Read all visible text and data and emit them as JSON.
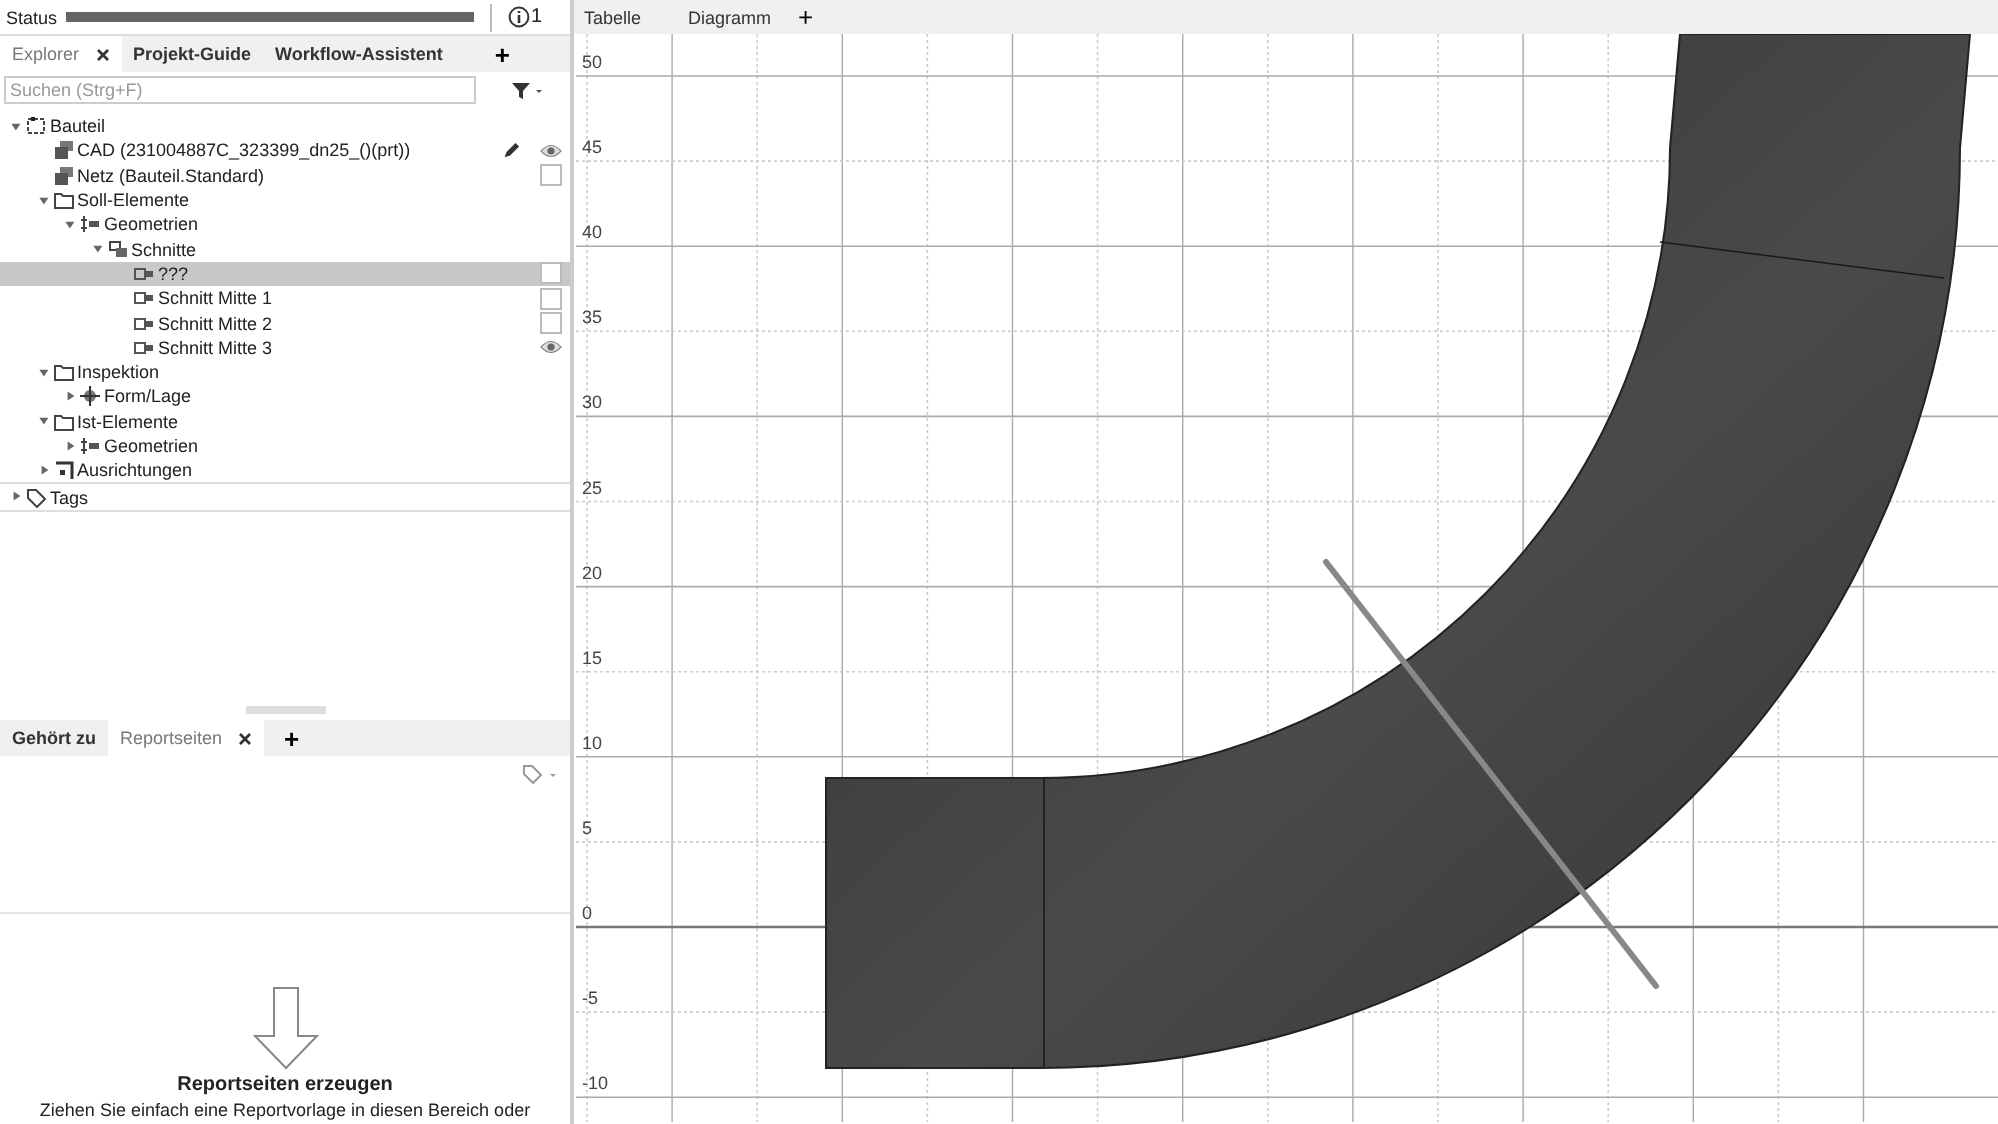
{
  "status_bar": {
    "label": "Status",
    "level": 1,
    "message_count": "1"
  },
  "left_tabs": [
    {
      "label": "Explorer",
      "selected": true,
      "closable": true
    },
    {
      "label": "Projekt-Guide",
      "selected": false,
      "closable": false
    },
    {
      "label": "Workflow-Assistent",
      "selected": false,
      "closable": false
    }
  ],
  "left_add_tab": "+",
  "search": {
    "placeholder": "Suchen (Strg+F)"
  },
  "tree": [
    {
      "label": "Bauteil",
      "kind": "part",
      "expanded": true,
      "children": [
        {
          "label": "CAD (231004887C_323399_dn25_()(prt))",
          "kind": "cad",
          "editable": true,
          "visible": true
        },
        {
          "label": "Netz (Bauteil.Standard)",
          "kind": "mesh",
          "visible": false
        },
        {
          "label": "Soll-Elemente",
          "kind": "folder",
          "expanded": true,
          "children": [
            {
              "label": "Geometrien",
              "kind": "geometry",
              "expanded": true,
              "children": [
                {
                  "label": "Schnitte",
                  "kind": "sections",
                  "expanded": true,
                  "children": [
                    {
                      "label": "???",
                      "kind": "section",
                      "selected": true,
                      "visible": false
                    },
                    {
                      "label": "Schnitt Mitte 1",
                      "kind": "section",
                      "selected": false,
                      "visible": false
                    },
                    {
                      "label": "Schnitt Mitte 2",
                      "kind": "section",
                      "selected": false,
                      "visible": false
                    },
                    {
                      "label": "Schnitt Mitte 3",
                      "kind": "section",
                      "selected": false,
                      "visible": true
                    }
                  ]
                }
              ]
            }
          ]
        },
        {
          "label": "Inspektion",
          "kind": "folder",
          "expanded": true,
          "children": [
            {
              "label": "Form/Lage",
              "kind": "inspection",
              "expanded": false
            }
          ]
        },
        {
          "label": "Ist-Elemente",
          "kind": "folder",
          "expanded": true,
          "children": [
            {
              "label": "Geometrien",
              "kind": "geometry",
              "expanded": false
            }
          ]
        },
        {
          "label": "Ausrichtungen",
          "kind": "alignment",
          "expanded": false
        }
      ]
    },
    {
      "label": "Tags",
      "kind": "tags",
      "expanded": false,
      "top_border": true
    }
  ],
  "bottom_tabs": [
    {
      "label": "Gehört zu",
      "selected": false,
      "closable": false
    },
    {
      "label": "Reportseiten",
      "selected": true,
      "closable": true
    }
  ],
  "bottom_add_tab": "+",
  "report_drop": {
    "title": "Reportseiten erzeugen",
    "text": "Ziehen Sie einfach eine Reportvorlage in diesen Bereich oder"
  },
  "view_tabs": [
    {
      "label": "Tabelle"
    },
    {
      "label": "Diagramm"
    }
  ],
  "view_add_tab": "+",
  "y_axis_labels": [
    "50",
    "45",
    "40",
    "35",
    "30",
    "25",
    "20",
    "15",
    "10",
    "5",
    "0",
    "-5",
    "-10"
  ]
}
